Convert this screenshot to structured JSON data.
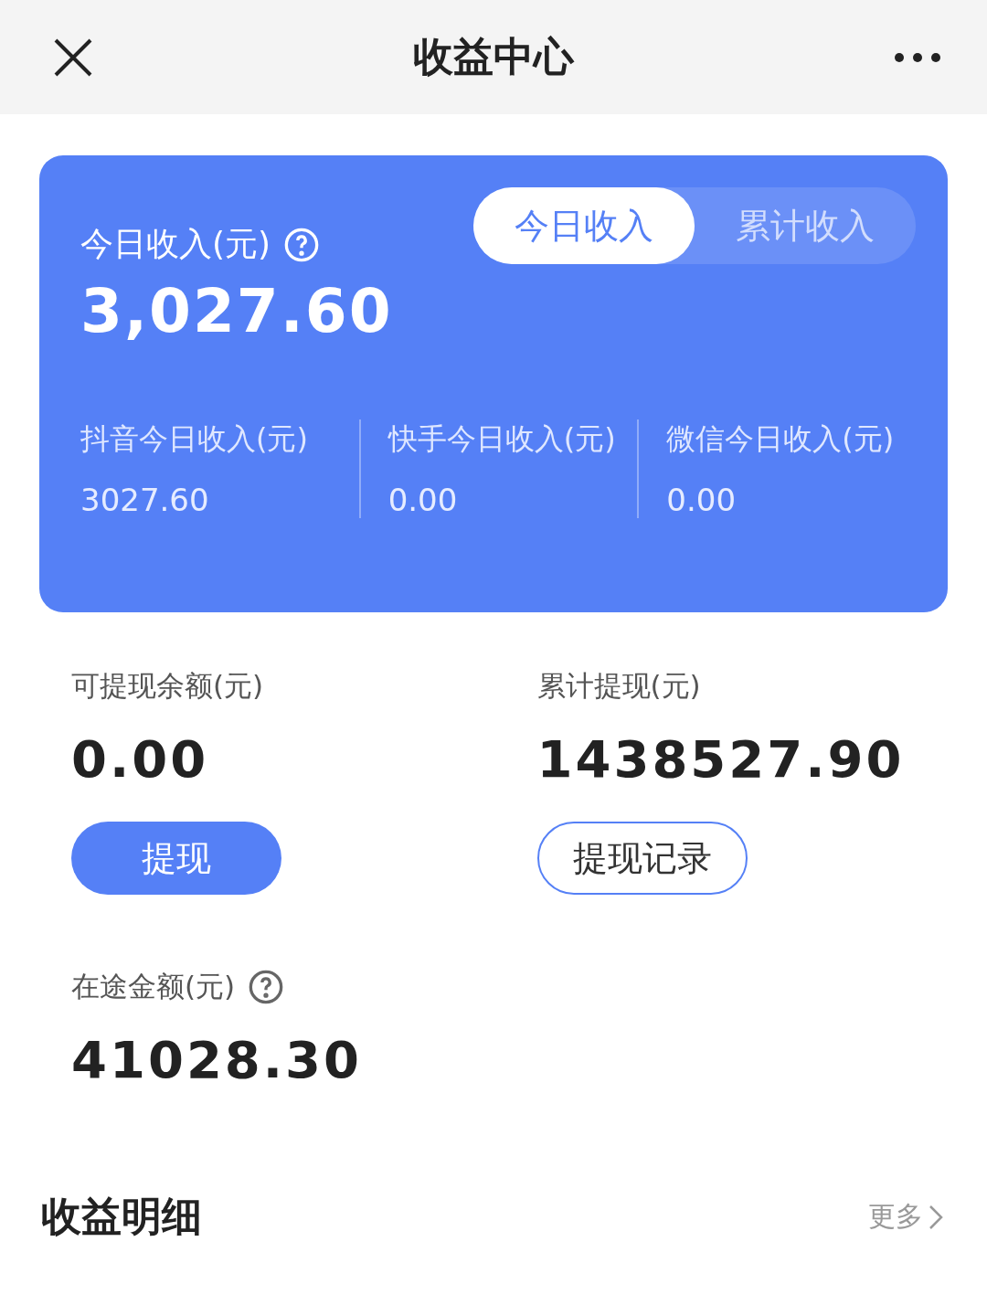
{
  "header": {
    "title": "收益中心"
  },
  "income_card": {
    "label": "今日收入(元)",
    "amount": "3,027.60",
    "tabs": [
      {
        "label": "今日收入",
        "selected": true
      },
      {
        "label": "累计收入",
        "selected": false
      }
    ],
    "platforms": [
      {
        "label": "抖音今日收入(元)",
        "value": "3027.60"
      },
      {
        "label": "快手今日收入(元)",
        "value": "0.00"
      },
      {
        "label": "微信今日收入(元)",
        "value": "0.00"
      }
    ]
  },
  "balances": [
    {
      "label": "可提现余额(元)",
      "value": "0.00",
      "button": {
        "label": "提现",
        "kind": "primary"
      }
    },
    {
      "label": "累计提现(元)",
      "value": "1438527.90",
      "button": {
        "label": "提现记录",
        "kind": "outline"
      }
    }
  ],
  "in_transit": {
    "label": "在途金额(元)",
    "value": "41028.30"
  },
  "details": {
    "title": "收益明细",
    "more": "更多"
  }
}
